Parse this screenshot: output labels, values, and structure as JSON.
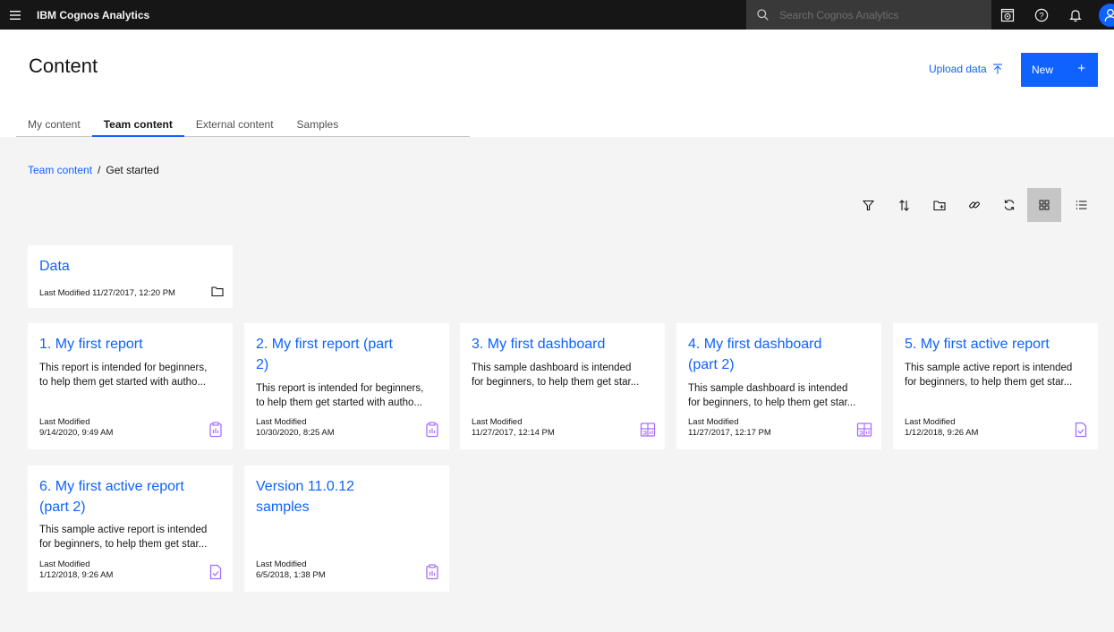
{
  "topbar": {
    "brand": "IBM Cognos Analytics",
    "search_placeholder": "Search Cognos Analytics",
    "icons": [
      "menu-icon",
      "search-icon",
      "screen-icon",
      "help-icon",
      "notification-icon",
      "user-icon"
    ]
  },
  "header": {
    "title": "Content",
    "upload_label": "Upload data",
    "new_label": "New",
    "new_plus": "+",
    "tabs": [
      "My content",
      "Team content",
      "External content",
      "Samples"
    ],
    "active_tab": "Team content"
  },
  "breadcrumb": {
    "root": "Team content",
    "sep": "/",
    "current": "Get started"
  },
  "toolbar": [
    "filter-icon",
    "sort-icon",
    "new-folder-icon",
    "link-icon",
    "refresh-icon",
    "grid-view-icon",
    "list-view-icon"
  ],
  "folder": {
    "title": "Data",
    "modified_label": "Last Modified",
    "modified": "11/27/2017, 12:20 PM",
    "icon": "folder-icon"
  },
  "cards": [
    {
      "title": "1. My first report",
      "desc1": "This report is intended for beginners,",
      "desc2": "to help them get started with autho...",
      "modified_label": "Last Modified",
      "modified": "9/14/2020, 9:49 AM",
      "icon": "report-icon"
    },
    {
      "title": "2. My first report (part",
      "title2": "2)",
      "desc1": "This report is intended for beginners,",
      "desc2": "to help them get started with autho...",
      "modified_label": "Last Modified",
      "modified": "10/30/2020, 8:25 AM",
      "icon": "report-icon"
    },
    {
      "title": "3. My first dashboard",
      "desc1": "This sample dashboard is intended",
      "desc2": "for beginners, to help them get star...",
      "modified_label": "Last Modified",
      "modified": "11/27/2017, 12:14 PM",
      "icon": "dashboard-icon"
    },
    {
      "title": "4. My first dashboard",
      "title2": "(part 2)",
      "desc1": "This sample dashboard is intended",
      "desc2": "for beginners, to help them get star...",
      "modified_label": "Last Modified",
      "modified": "11/27/2017, 12:17 PM",
      "icon": "dashboard-icon"
    },
    {
      "title": "5. My first active report",
      "desc1": "This sample active report is intended",
      "desc2": "for beginners, to help them get star...",
      "modified_label": "Last Modified",
      "modified": "1/12/2018, 9:26 AM",
      "icon": "active-report-icon"
    },
    {
      "title": "6. My first active report",
      "title2": "(part 2)",
      "desc1": "This sample active report is intended",
      "desc2": "for beginners, to help them get star...",
      "modified_label": "Last Modified",
      "modified": "1/12/2018, 9:26 AM",
      "icon": "active-report-icon"
    },
    {
      "title": "Version 11.0.12",
      "title2": "samples",
      "modified_label": "Last Modified",
      "modified": "6/5/2018, 1:38 PM",
      "icon": "report-icon"
    }
  ],
  "colors": {
    "accent": "#0f62fe",
    "topbar": "#161616",
    "icon_purple": "#a56eff"
  }
}
